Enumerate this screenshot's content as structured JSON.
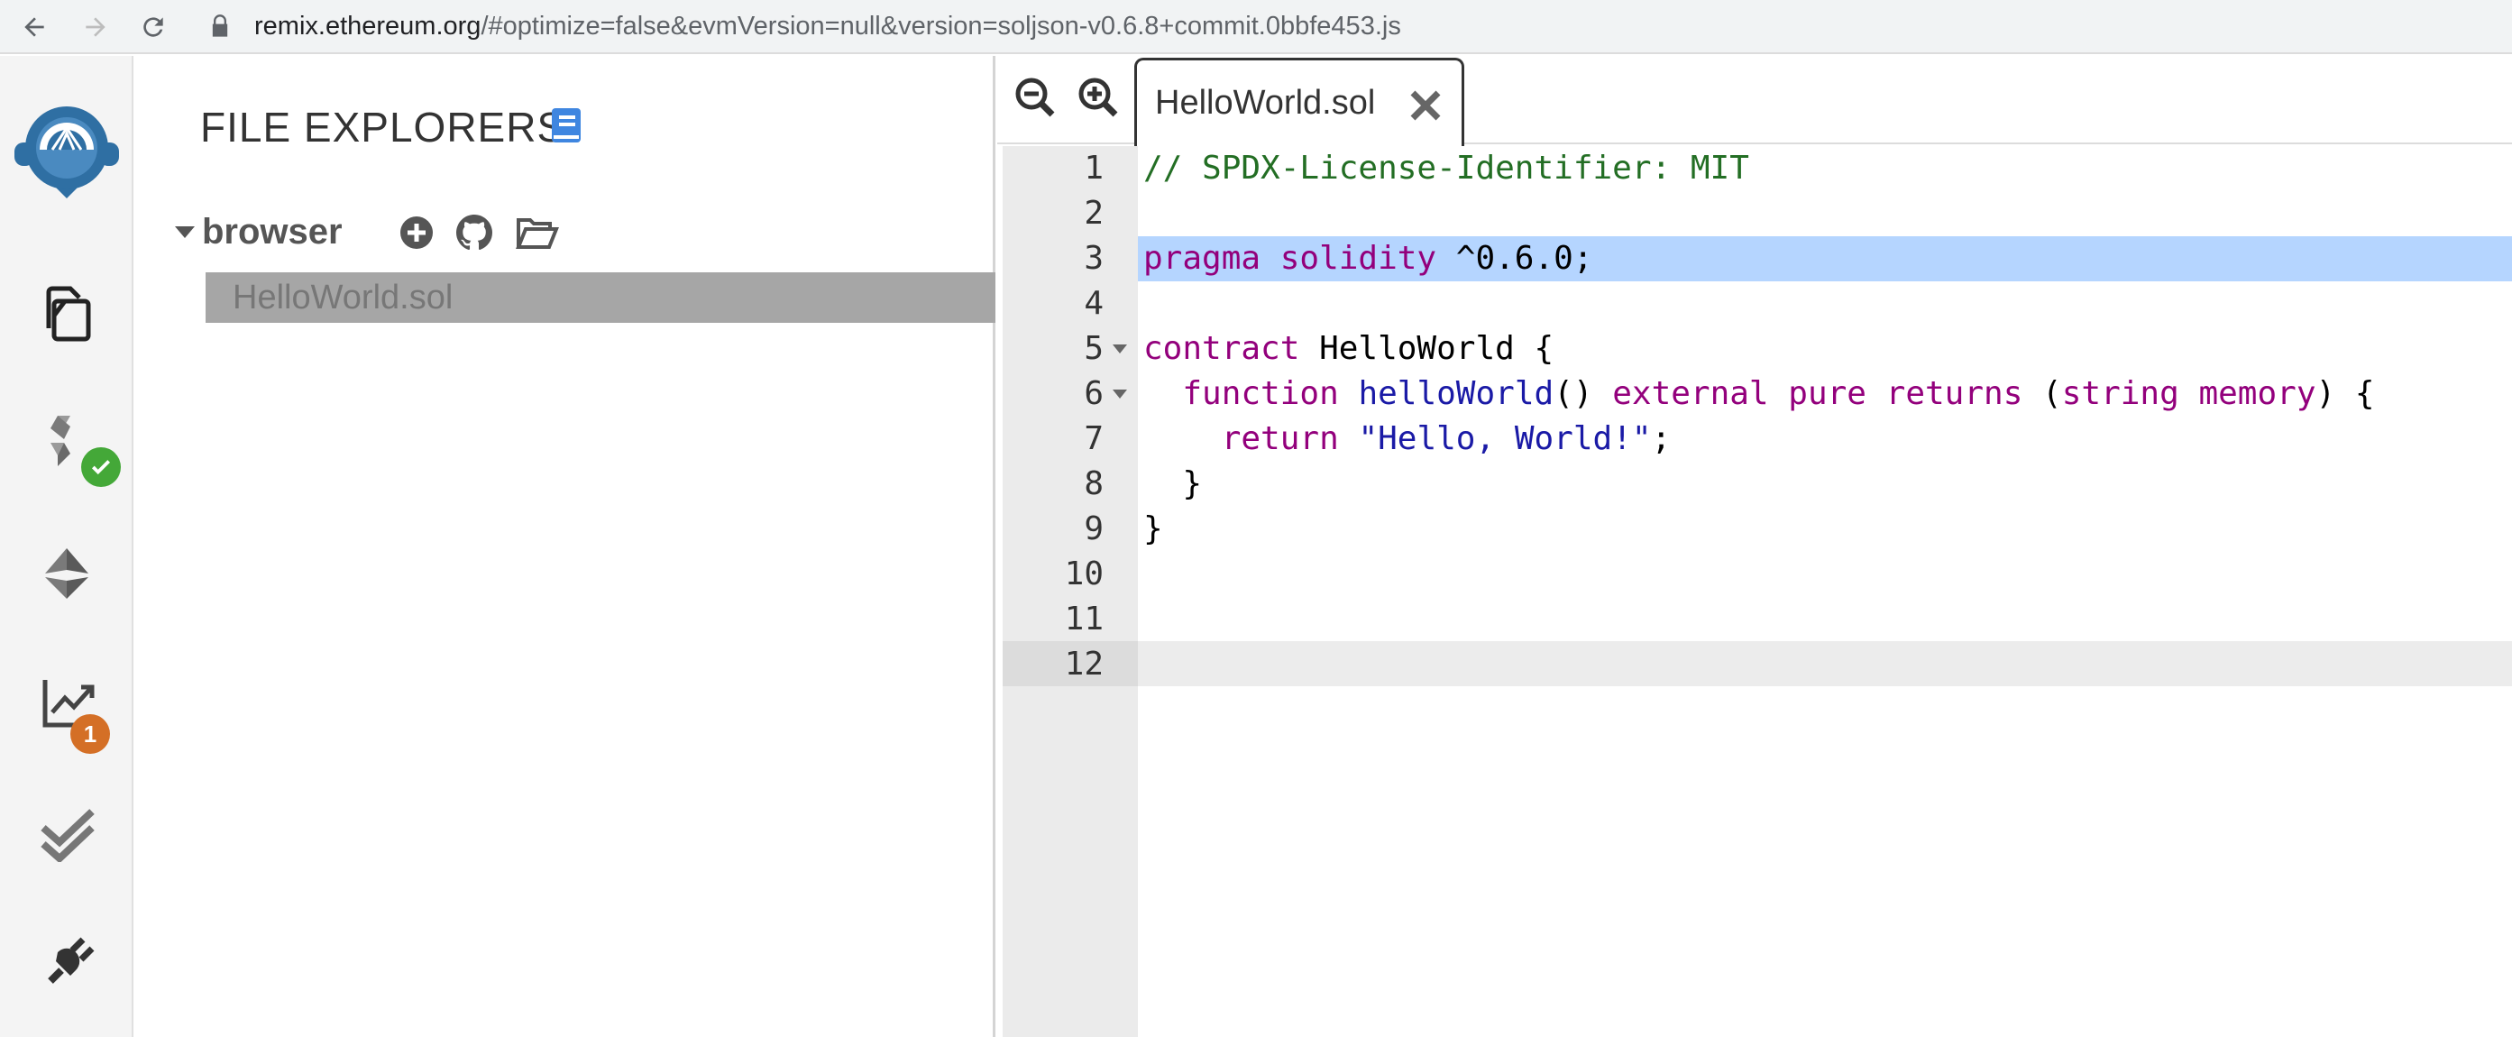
{
  "browser": {
    "url_host": "remix.ethereum.org",
    "url_rest": "/#optimize=false&evmVersion=null&version=soljson-v0.6.8+commit.0bbfe453.js"
  },
  "rail": {
    "icons": [
      "file-explorer-icon",
      "solidity-compiler-icon",
      "deploy-run-icon",
      "analysis-icon",
      "testing-icon",
      "plugin-manager-icon"
    ],
    "analysis_badge": "1",
    "colors": {
      "success": "#44a838",
      "warning": "#d46f26"
    }
  },
  "explorer": {
    "title": "FILE EXPLORERS",
    "workspace": "browser",
    "files": [
      {
        "name": "HelloWorld.sol"
      }
    ]
  },
  "editor": {
    "tab_label": "HelloWorld.sol",
    "lines": [
      {
        "n": "1",
        "text": "// SPDX-License-Identifier: MIT"
      },
      {
        "n": "2",
        "text": ""
      },
      {
        "n": "3",
        "text": "pragma solidity ^0.6.0;"
      },
      {
        "n": "4",
        "text": ""
      },
      {
        "n": "5",
        "text": "contract HelloWorld {"
      },
      {
        "n": "6",
        "text": "  function helloWorld() external pure returns (string memory) {"
      },
      {
        "n": "7",
        "text": "    return \"Hello, World!\";"
      },
      {
        "n": "8",
        "text": "  }"
      },
      {
        "n": "9",
        "text": "}"
      },
      {
        "n": "10",
        "text": ""
      },
      {
        "n": "11",
        "text": ""
      },
      {
        "n": "12",
        "text": ""
      }
    ],
    "selected_line": "3",
    "cursor_line": "12"
  }
}
